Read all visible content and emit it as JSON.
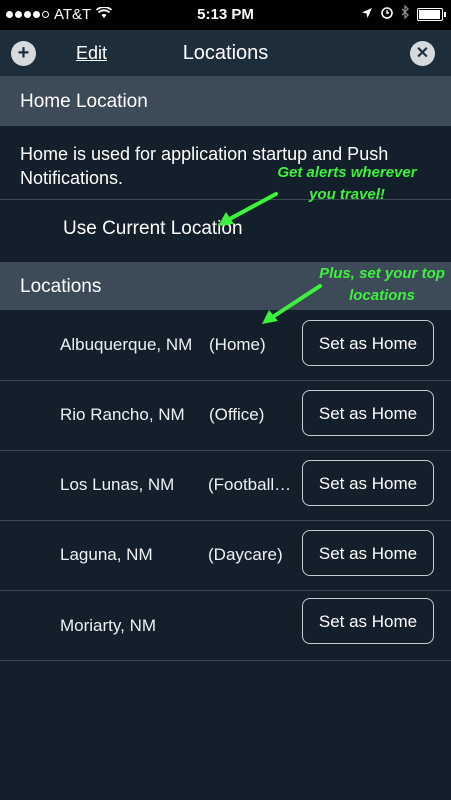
{
  "status_bar": {
    "carrier": "AT&T",
    "time": "5:13 PM",
    "signal_bars": 4,
    "battery_level": 0.95
  },
  "nav": {
    "add_icon": "plus-icon",
    "edit_label": "Edit",
    "title": "Locations",
    "close_icon": "close-icon"
  },
  "home_section": {
    "header": "Home Location",
    "description": "Home is used for application startup and Push Notifications.",
    "use_current_label": "Use Current Location"
  },
  "locations_section": {
    "header": "Locations",
    "items": [
      {
        "name": "Albuquerque, NM",
        "tag": "(Home)",
        "button": "Set as Home"
      },
      {
        "name": "Rio Rancho, NM",
        "tag": "(Office)",
        "button": "Set as Home"
      },
      {
        "name": "Los Lunas, NM",
        "tag": "(Football…",
        "button": "Set as Home"
      },
      {
        "name": "Laguna, NM",
        "tag": "(Daycare)",
        "button": "Set as Home"
      },
      {
        "name": "Moriarty, NM",
        "tag": "",
        "button": "Set as Home"
      }
    ]
  },
  "annotations": {
    "first": "Get alerts wherever you travel!",
    "second": "Plus, set your top locations"
  },
  "colors": {
    "background": "#13202c",
    "section_header": "#3c4b57",
    "annotation": "#3df23d"
  }
}
